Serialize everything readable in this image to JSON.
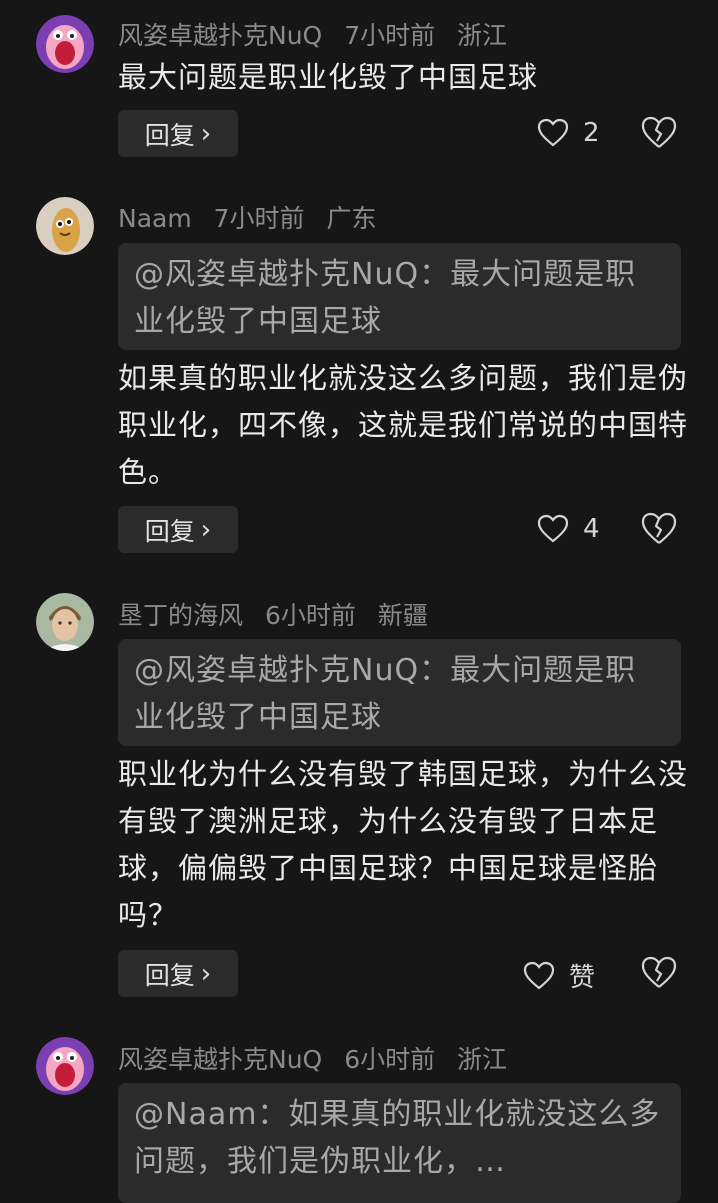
{
  "comments": [
    {
      "username": "风姿卓越扑克NuQ",
      "time": "7小时前",
      "location": "浙江",
      "quote": "",
      "text": "最大问题是职业化毁了中国足球",
      "reply_label": "回复",
      "like_count": "2"
    },
    {
      "username": "Naam",
      "time": "7小时前",
      "location": "广东",
      "quote": "@风姿卓越扑克NuQ：最大问题是职业化毁了中国足球",
      "text": "如果真的职业化就没这么多问题，我们是伪职业化，四不像，这就是我们常说的中国特色。",
      "reply_label": "回复",
      "like_count": "4"
    },
    {
      "username": "垦丁的海风",
      "time": "6小时前",
      "location": "新疆",
      "quote": "@风姿卓越扑克NuQ：最大问题是职业化毁了中国足球",
      "text": "职业化为什么没有毁了韩国足球，为什么没有毁了澳洲足球，为什么没有毁了日本足球，偏偏毁了中国足球？中国足球是怪胎吗？",
      "reply_label": "回复",
      "like_count": "赞"
    },
    {
      "username": "风姿卓越扑克NuQ",
      "time": "6小时前",
      "location": "浙江",
      "quote": "@Naam：如果真的职业化就没这么多问题，我们是伪职业化，…",
      "text": "",
      "reply_label": "",
      "like_count": ""
    }
  ],
  "icons": {
    "chevron": "›"
  }
}
